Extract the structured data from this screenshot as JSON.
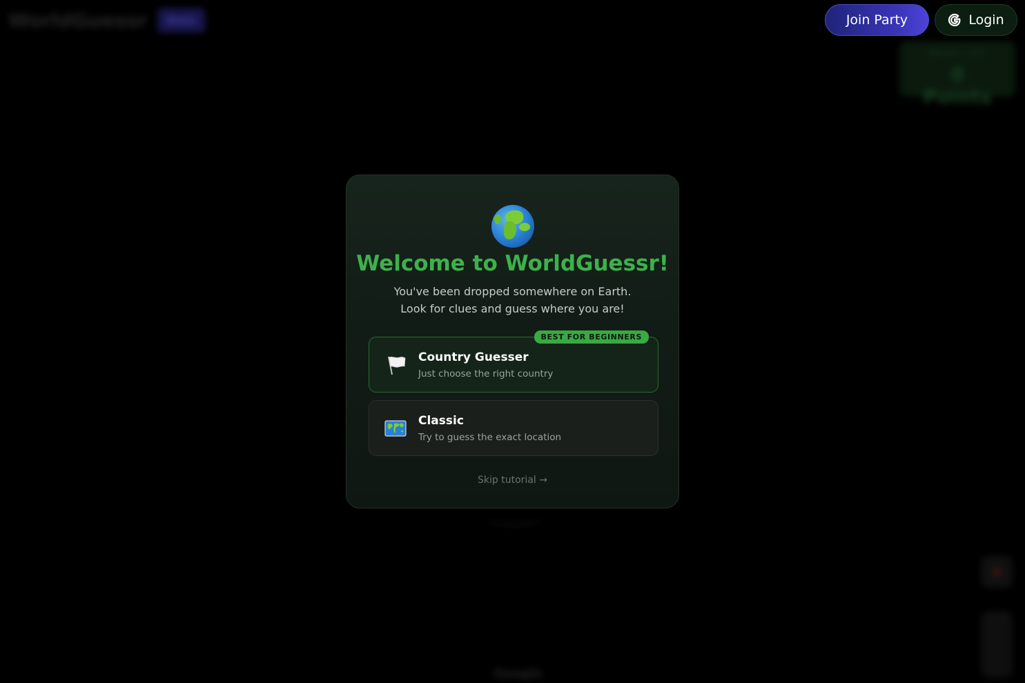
{
  "background": {
    "logo_text": "WorldGuessr",
    "beta_badge": "Beta",
    "score": {
      "round_label": "Round 1 of 5",
      "points": "0 Points"
    },
    "attribution": "Google"
  },
  "header": {
    "join_party_label": "Join Party",
    "login_label": "Login",
    "login_icon": "google-g-icon"
  },
  "modal": {
    "icon": "globe-europe-africa-icon",
    "title": "Welcome to WorldGuessr!",
    "subtitle_line1": "You've been dropped somewhere on Earth.",
    "subtitle_line2": "Look for clues and guess where you are!",
    "modes": [
      {
        "icon": "white-flag-icon",
        "title": "Country Guesser",
        "description": "Just choose the right country",
        "badge": "BEST FOR BEGINNERS"
      },
      {
        "icon": "world-map-icon",
        "title": "Classic",
        "description": "Try to guess the exact location"
      }
    ],
    "skip_label": "Skip tutorial →"
  },
  "colors": {
    "accent_green": "#3db14c",
    "party_purple": "#3a35b8",
    "modal_bg": "#131d17"
  }
}
